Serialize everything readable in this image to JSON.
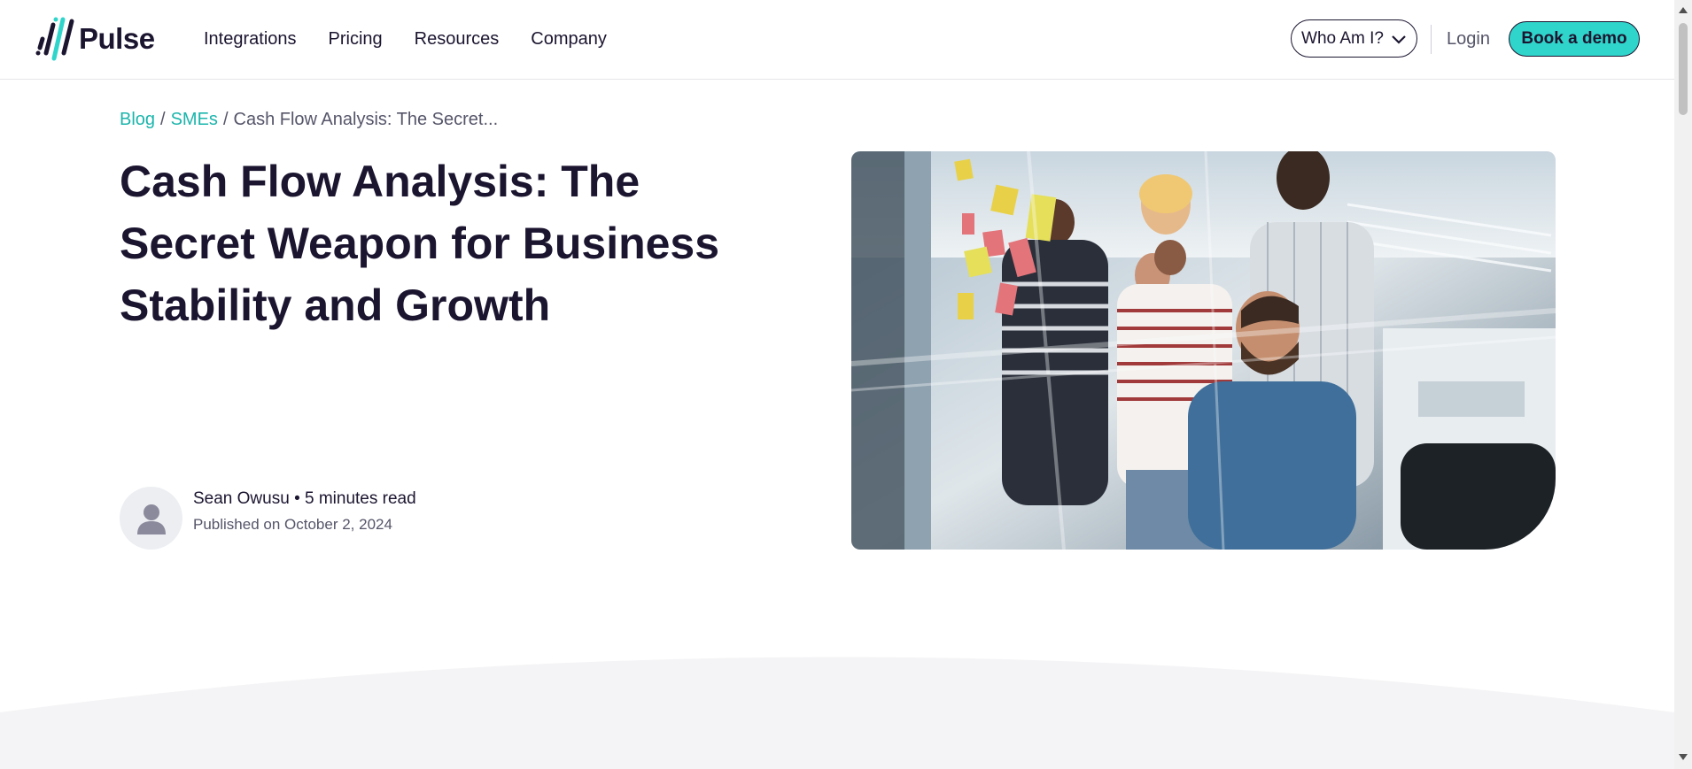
{
  "header": {
    "logo_text": "Pulse",
    "nav": [
      "Integrations",
      "Pricing",
      "Resources",
      "Company"
    ],
    "who_am_i": "Who Am I?",
    "login": "Login",
    "demo": "Book a demo"
  },
  "breadcrumb": {
    "blog": "Blog",
    "sep1": "/",
    "smes": "SMEs",
    "sep2": "/",
    "current": "Cash Flow Analysis: The Secret..."
  },
  "article": {
    "title": "Cash Flow Analysis: The Secret Weapon for Business Stability and Growth",
    "author_line": "Sean Owusu • 5 minutes read",
    "published": "Published on October 2, 2024"
  },
  "colors": {
    "accent": "#2fd5cb",
    "link": "#1bb5ac",
    "text": "#1c1530",
    "wave": "#f4f4f6"
  },
  "icons": {
    "logo": "pulse-logo-icon",
    "dropdown": "chevron-down-icon",
    "avatar": "person-icon"
  }
}
